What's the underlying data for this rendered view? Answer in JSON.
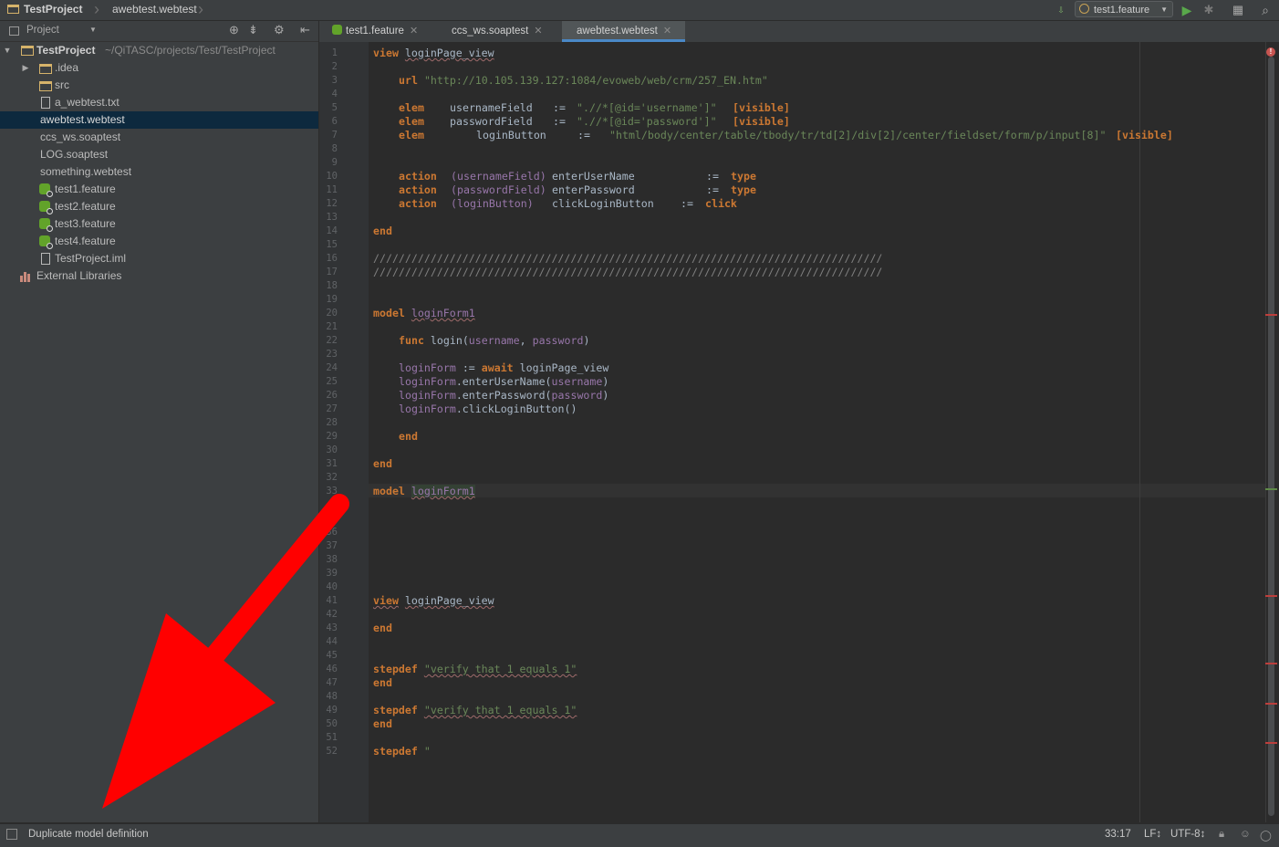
{
  "navbar": {
    "project_name": "TestProject",
    "current_file": "awebtest.webtest",
    "run_config": "test1.feature"
  },
  "project_panel": {
    "view_label": "Project",
    "tree": [
      {
        "label": "TestProject",
        "suffix": "~/QiTASC/projects/Test/TestProject",
        "icon": "project-folder-icon",
        "expanded": true
      },
      {
        "label": ".idea",
        "icon": "folder-icon",
        "collapsed": true
      },
      {
        "label": "src",
        "icon": "folder-icon"
      },
      {
        "label": "a_webtest.txt",
        "icon": "text-file-icon"
      },
      {
        "label": "awebtest.webtest",
        "icon": "none",
        "selected": true
      },
      {
        "label": "ccs_ws.soaptest",
        "icon": "none"
      },
      {
        "label": "LOG.soaptest",
        "icon": "none"
      },
      {
        "label": "something.webtest",
        "icon": "none"
      },
      {
        "label": "test1.feature",
        "icon": "cucumber-feature-icon"
      },
      {
        "label": "test2.feature",
        "icon": "cucumber-feature-icon"
      },
      {
        "label": "test3.feature",
        "icon": "cucumber-feature-icon"
      },
      {
        "label": "test4.feature",
        "icon": "cucumber-feature-icon"
      },
      {
        "label": "TestProject.iml",
        "icon": "iml-file-icon"
      },
      {
        "label": "External Libraries",
        "icon": "library-icon"
      }
    ]
  },
  "tabs": [
    {
      "label": "test1.feature",
      "icon": "cucumber-feature-icon",
      "active": false
    },
    {
      "label": "ccs_ws.soaptest",
      "active": false
    },
    {
      "label": "awebtest.webtest",
      "active": true
    }
  ],
  "editor": {
    "line_numbers": [
      "1",
      "2",
      "3",
      "4",
      "5",
      "6",
      "7",
      "8",
      "9",
      "10",
      "11",
      "12",
      "13",
      "14",
      "15",
      "16",
      "17",
      "18",
      "19",
      "20",
      "21",
      "22",
      "23",
      "24",
      "25",
      "26",
      "27",
      "28",
      "29",
      "30",
      "31",
      "32",
      "33",
      "36",
      "37",
      "38",
      "39",
      "40",
      "41",
      "42",
      "43",
      "44",
      "45",
      "46",
      "47",
      "48",
      "49",
      "50",
      "51",
      "52"
    ],
    "code": {
      "kw_view": "view",
      "login_page_view": "loginPage_view",
      "kw_url": "url",
      "url_value": "\"http://10.105.139.127:1084/evoweb/web/crm/257_EN.htm\"",
      "kw_elem": "elem",
      "username_field": "usernameField",
      "password_field": "passwordField",
      "login_button": "loginButton",
      "assign": ":=",
      "xpath_username": "\".//*[@id='username']\"",
      "xpath_password": "\".//*[@id='password']\"",
      "xpath_button": "\"html/body/center/table/tbody/tr/td[2]/div[2]/center/fieldset/form/p/input[8]\"",
      "visible_tag": "[visible]",
      "kw_action": "action",
      "p_username_field": "(usernameField)",
      "p_password_field": "(passwordField)",
      "p_login_button": "(loginButton)",
      "enter_user_name": "enterUserName",
      "enter_password": "enterPassword",
      "click_login_button": "clickLoginButton",
      "kw_type": "type",
      "kw_click": "click",
      "kw_end": "end",
      "comment_slashes": "////////////////////////////////////////////////////////////////////////////////",
      "kw_model": "model",
      "login_form1": "loginForm1",
      "kw_func": "func",
      "login_func": "login",
      "open_paren": "(",
      "param_username": "username",
      "comma": ", ",
      "param_password": "password",
      "close_paren": ")",
      "login_form_var": "loginForm",
      "kw_await": "await",
      "dot_enter_user_name": ".enterUserName(",
      "dot_enter_password": ".enterPassword(",
      "dot_click_login": ".clickLoginButton()",
      "kw_stepdef": "stepdef",
      "step_verify": "\"verify that 1 equals 1\"",
      "step_open": "\""
    }
  },
  "statusbar": {
    "message": "Duplicate model definition",
    "caret_position": "33:17",
    "line_separator": "LF↕",
    "encoding": "UTF-8↕"
  },
  "colors": {
    "keyword": "#cc7832",
    "string": "#6a8759",
    "parameter": "#9876aa",
    "function": "#ffc66d",
    "annotation_arrow": "#ff0000",
    "error_marker": "#bc3f3c"
  }
}
